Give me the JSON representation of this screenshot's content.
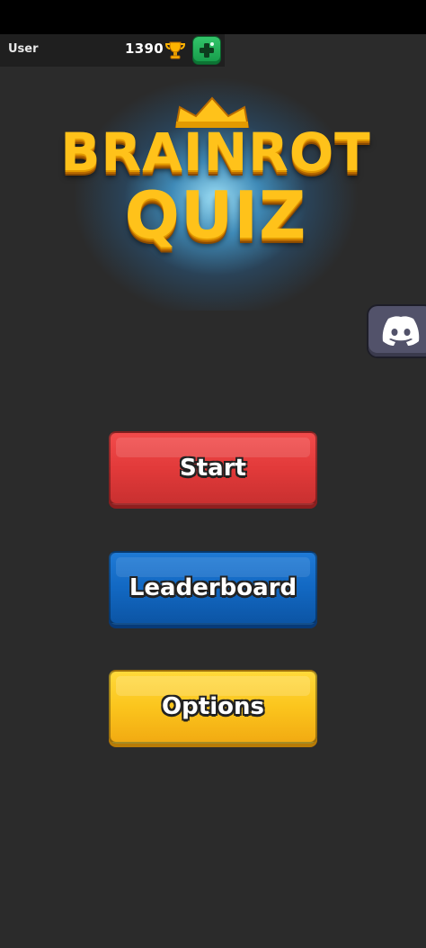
{
  "header": {
    "username": "User",
    "trophy_count": "1390",
    "trophy_icon": "trophy-icon",
    "add_icon": "plus-icon"
  },
  "logo": {
    "line1": "BRAINROT",
    "line2": "QUIZ",
    "crown_icon": "crown-icon"
  },
  "social": {
    "discord_icon": "discord-icon"
  },
  "menu": {
    "start_label": "Start",
    "leaderboard_label": "Leaderboard",
    "options_label": "Options"
  },
  "colors": {
    "background": "#2b2b2b",
    "start": "#e23a3a",
    "leaderboard": "#1268c2",
    "options": "#fbc51d",
    "logo_gold": "#ffc21a"
  }
}
